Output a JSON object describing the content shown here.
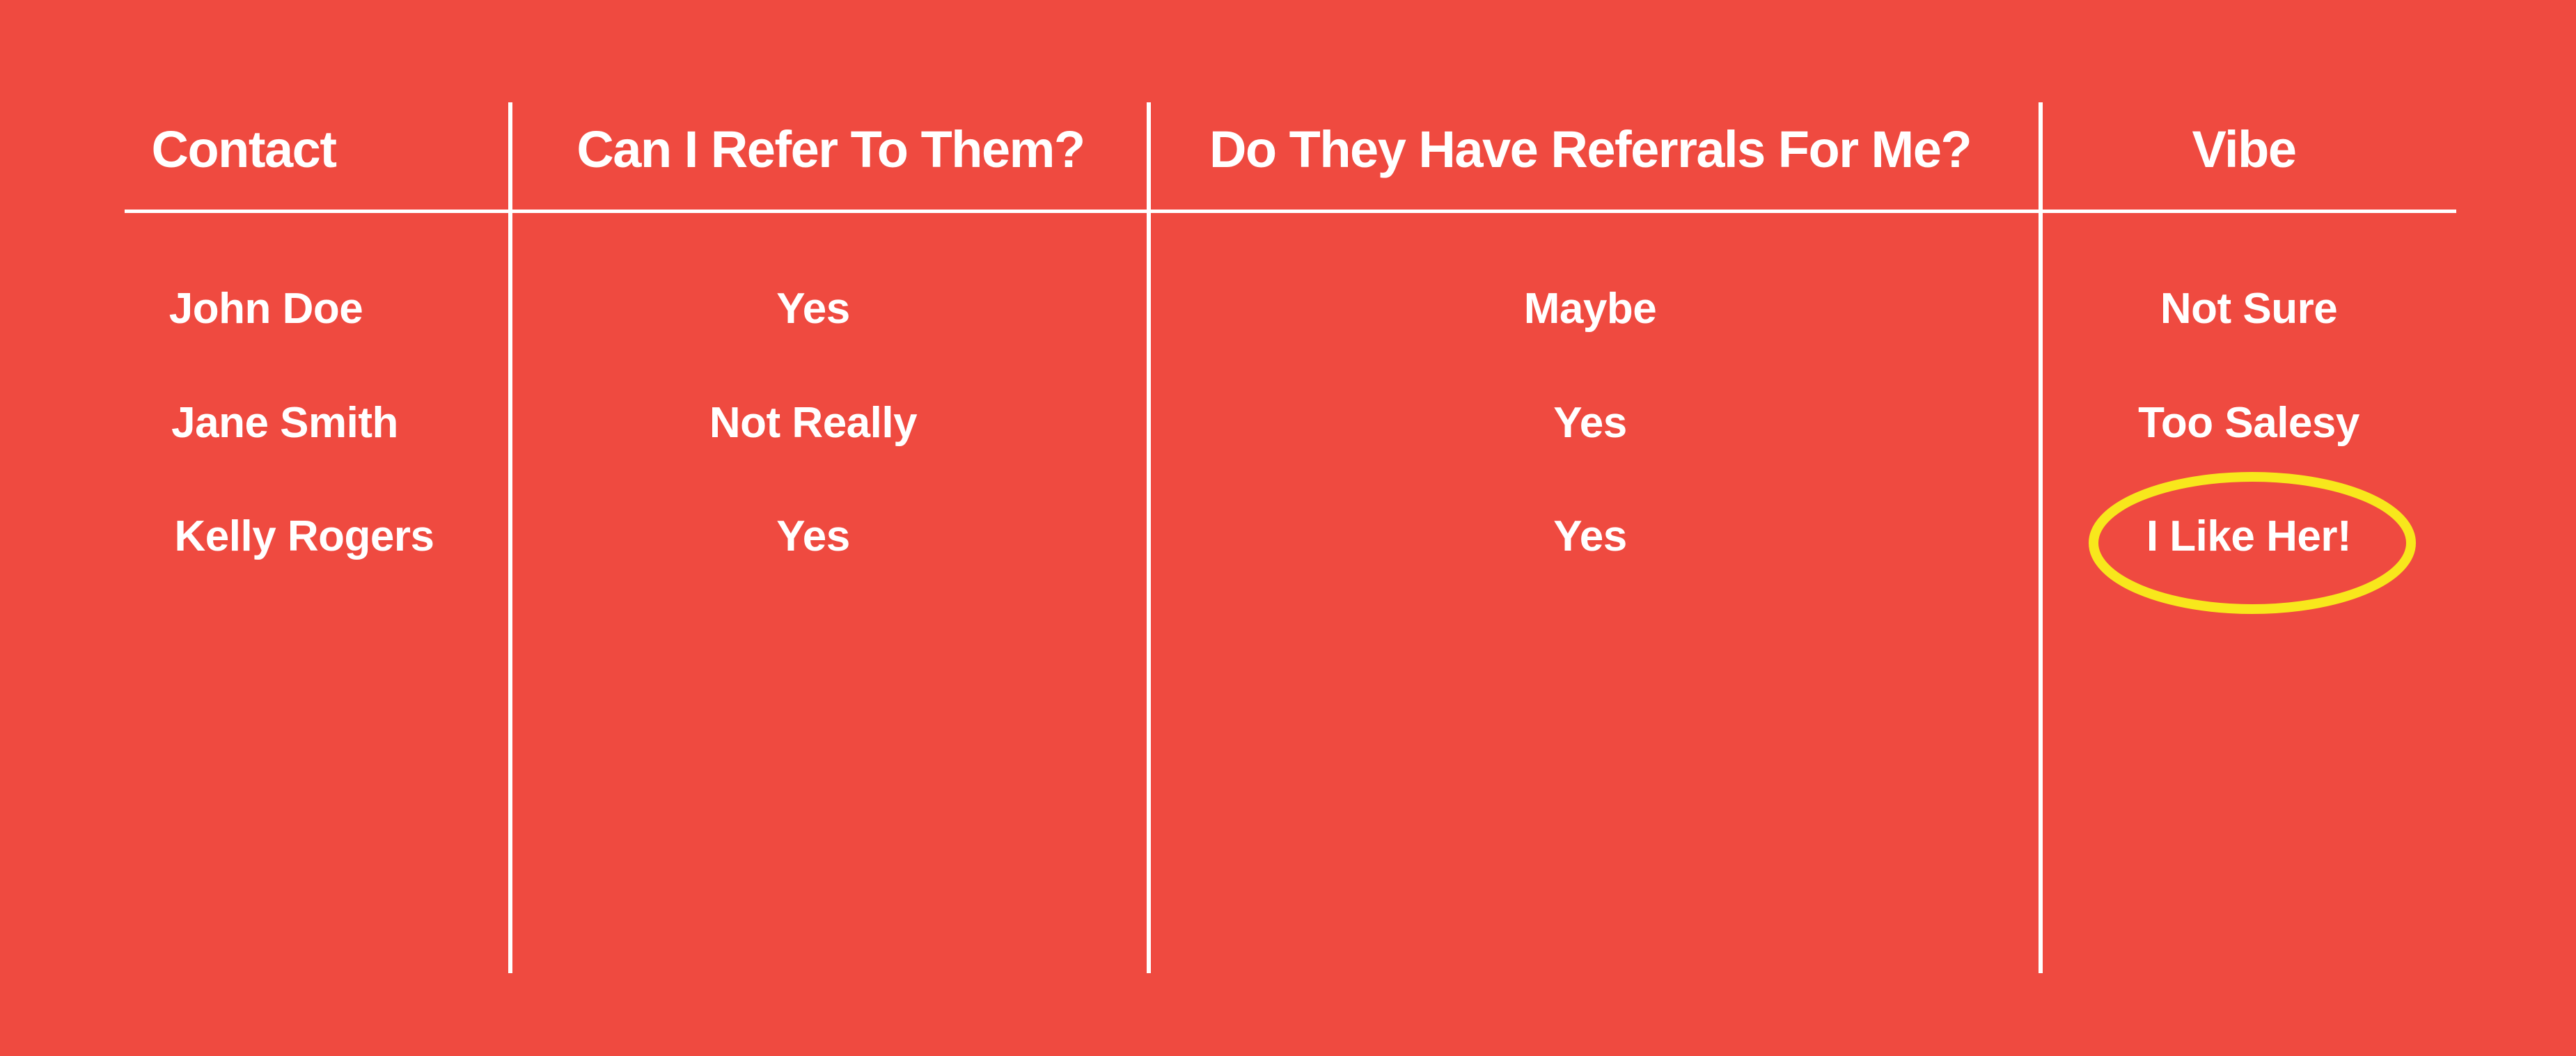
{
  "table": {
    "headers": [
      "Contact",
      "Can I Refer To Them?",
      "Do They Have Referrals For Me?",
      "Vibe"
    ],
    "rows": [
      [
        "John Doe",
        "Yes",
        "Maybe",
        "Not Sure"
      ],
      [
        "Jane Smith",
        "Not Really",
        "Yes",
        "Too Salesy"
      ],
      [
        "Kelly Rogers",
        "Yes",
        "Yes",
        "I Like Her!"
      ]
    ]
  },
  "highlight": {
    "row": 2,
    "column": 3,
    "shape": "ellipse",
    "color": "#F8E71C"
  },
  "colors": {
    "background": "#EF4A40",
    "text": "#FFFFFF",
    "rules": "#FFFFFF"
  }
}
